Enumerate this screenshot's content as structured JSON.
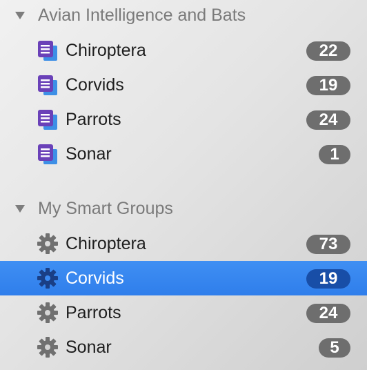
{
  "sections": [
    {
      "title": "Avian Intelligence and Bats",
      "item_icon": "document-stack-icon",
      "items": [
        {
          "label": "Chiroptera",
          "count": "22"
        },
        {
          "label": "Corvids",
          "count": "19"
        },
        {
          "label": "Parrots",
          "count": "24"
        },
        {
          "label": "Sonar",
          "count": "1"
        }
      ]
    },
    {
      "title": "My Smart Groups",
      "item_icon": "gear-icon",
      "items": [
        {
          "label": "Chiroptera",
          "count": "73"
        },
        {
          "label": "Corvids",
          "count": "19",
          "selected": true
        },
        {
          "label": "Parrots",
          "count": "24"
        },
        {
          "label": "Sonar",
          "count": "5"
        }
      ]
    }
  ],
  "colors": {
    "selection": "#3a89f1",
    "badge": "#6e6e6e",
    "badge_selected": "#184ea7",
    "doc_icon": "#6a41b8",
    "gear_icon": "#707070"
  }
}
